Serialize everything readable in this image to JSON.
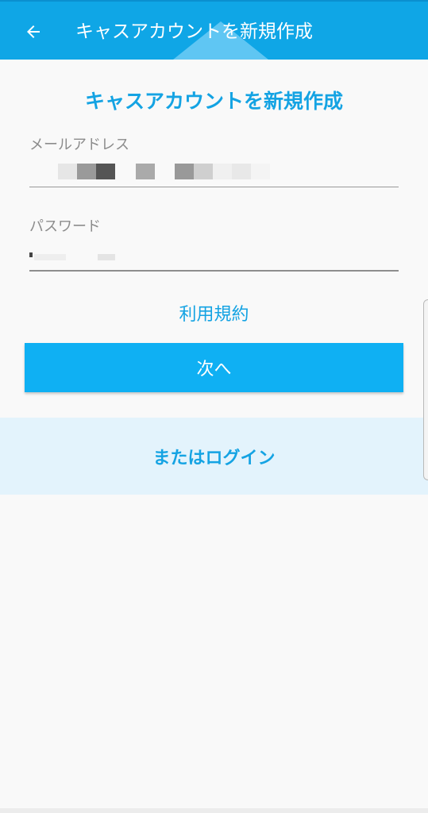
{
  "app_bar": {
    "title": "キャスアカウントを新規作成",
    "back_icon": "arrow-left-icon",
    "background": "#0fa6e6"
  },
  "form": {
    "heading": "キャスアカウントを新規作成",
    "email_label": "メールアドレス",
    "password_label": "パスワード",
    "terms_link": "利用規約",
    "next_button": "次へ"
  },
  "login": {
    "link": "またはログイン"
  },
  "colors": {
    "accent": "#14a3e3",
    "button": "#0fb0f3",
    "login_panel": "#e3f3fc"
  }
}
